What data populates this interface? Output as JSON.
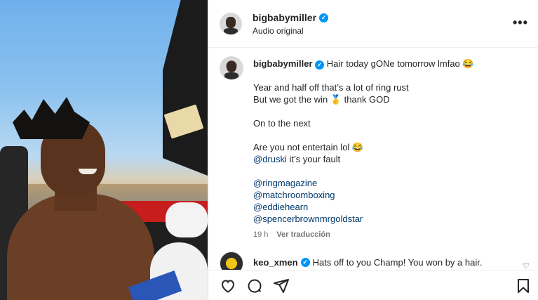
{
  "post": {
    "username": "bigbabymiller",
    "audio": "Audio original",
    "more_label": "•••"
  },
  "caption": {
    "username": "bigbabymiller",
    "first_line": "Hair today gONe tomorrow lmfao 😂",
    "lines": [
      "Year and half off that’s a lot of ring rust",
      "But we got the win 🥇 thank GOD",
      "",
      "On to the next",
      "",
      "Are you not entertain lol 😂"
    ],
    "mention_line": {
      "mention": "@druski",
      "text": " it’s your fault"
    },
    "tags": [
      "@ringmagazine",
      "@matchroomboxing",
      "@eddiehearn",
      "@spencerbrownmrgoldstar"
    ],
    "time": "19 h",
    "translate": "Ver traducción"
  },
  "comment": {
    "username": "keo_xmen",
    "text": "Hats off to you Champ! You won by a hair."
  },
  "icons": {
    "verified": "verified-badge-icon",
    "like": "heart-icon",
    "comment": "comment-icon",
    "share": "send-icon",
    "save": "bookmark-icon"
  },
  "colors": {
    "verified": "#0095f6",
    "mention": "#00376b",
    "secondary_text": "#737373"
  }
}
